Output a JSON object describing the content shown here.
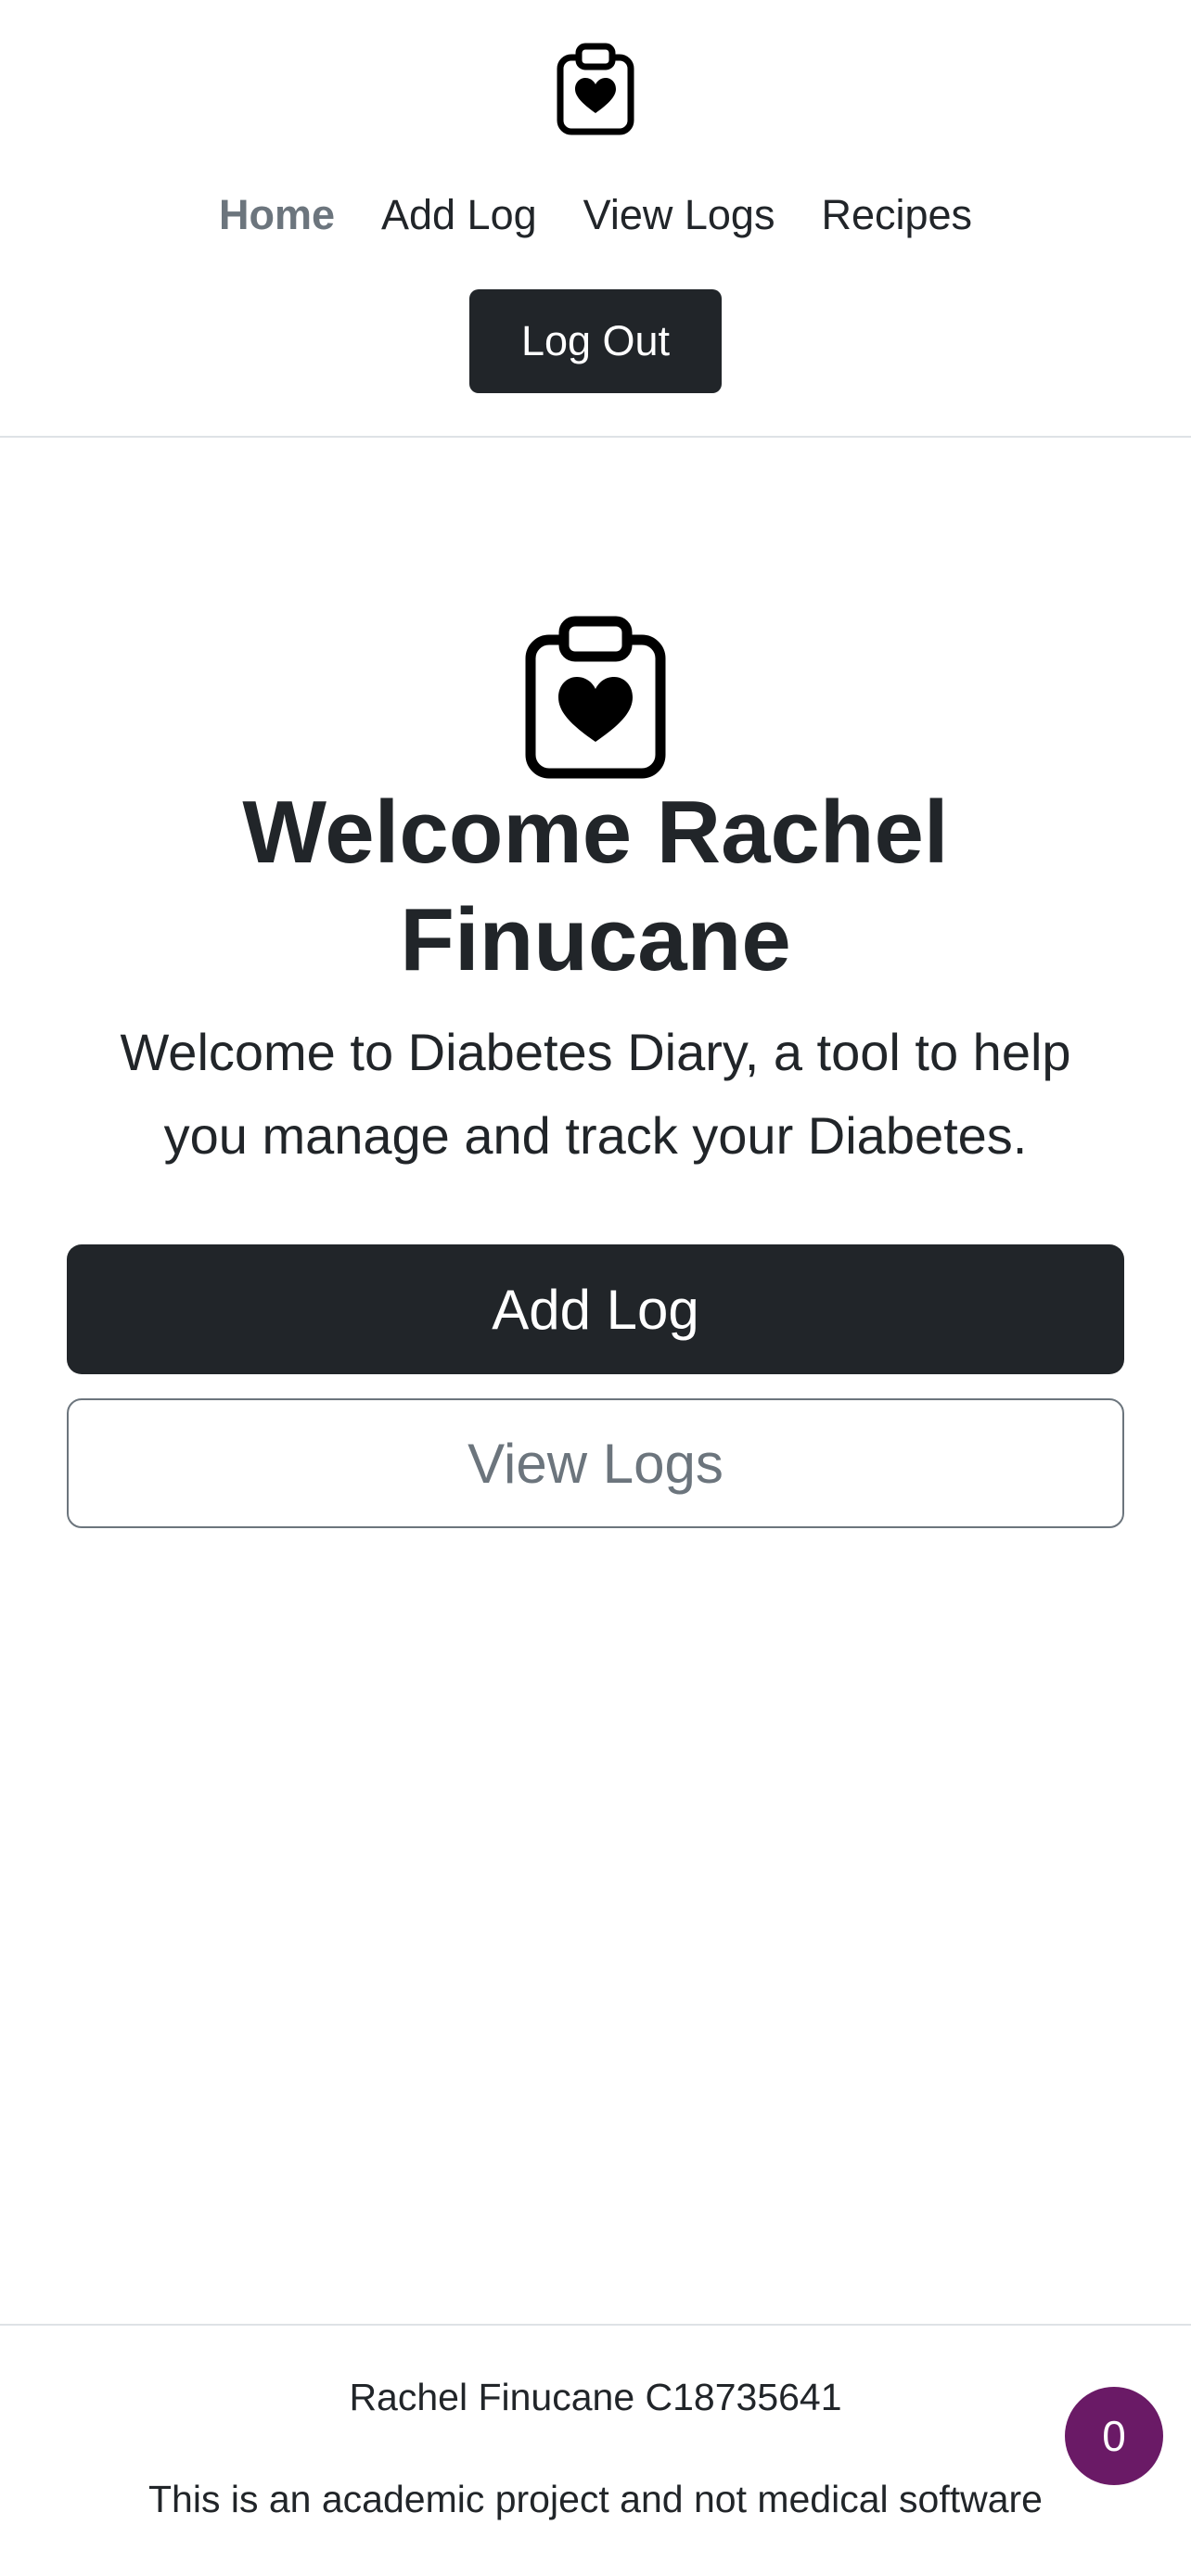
{
  "header": {
    "logo_icon": "clipboard-heart-icon",
    "nav": [
      {
        "label": "Home",
        "active": true
      },
      {
        "label": "Add Log",
        "active": false
      },
      {
        "label": "View Logs",
        "active": false
      },
      {
        "label": "Recipes",
        "active": false
      }
    ],
    "logout_label": "Log Out"
  },
  "hero": {
    "icon": "clipboard-heart-icon",
    "title": "Welcome Rachel Finucane",
    "lead": "Welcome to Diabetes Diary, a tool to help you manage and track your Diabetes.",
    "add_log_label": "Add Log",
    "view_logs_label": "View Logs"
  },
  "footer": {
    "name_line": "Rachel Finucane C18735641",
    "note": "This is an academic project and not medical software"
  },
  "notification": {
    "count": "0"
  },
  "colors": {
    "dark": "#212529",
    "muted": "#6c757d",
    "badge": "#6a1a66",
    "divider": "#dee2e6"
  }
}
